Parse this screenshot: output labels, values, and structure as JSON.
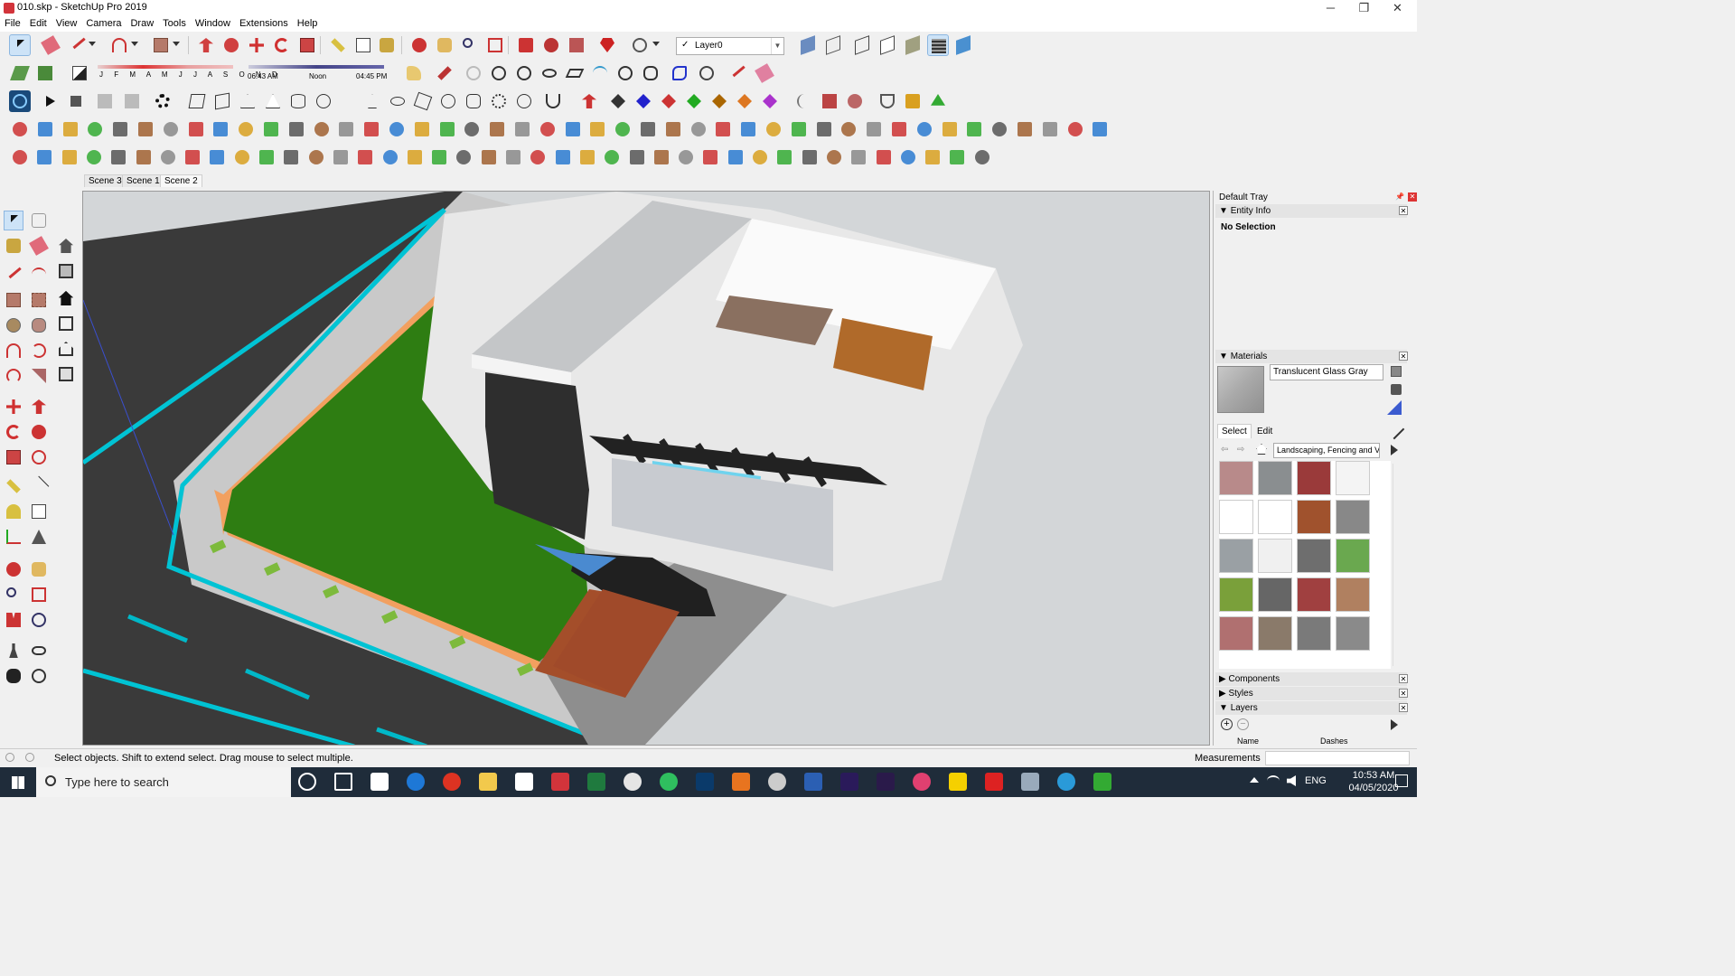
{
  "window": {
    "title": "010.skp - SketchUp Pro 2019",
    "minimize": "─",
    "maximize": "❐",
    "close": "✕"
  },
  "menu": [
    "File",
    "Edit",
    "View",
    "Camera",
    "Draw",
    "Tools",
    "Window",
    "Extensions",
    "Help"
  ],
  "layer_select": {
    "check": "✓",
    "value": "Layer0",
    "arrow": "▼"
  },
  "shadow": {
    "months": "J F M A M J J A S O N D",
    "time_start": "06:43 AM",
    "time_mid": "Noon",
    "time_end": "04:45 PM"
  },
  "scenes": [
    "Scene 3",
    "Scene 1",
    "Scene 2"
  ],
  "active_scene": "Scene 2",
  "tray": {
    "title": "Default Tray",
    "entity_info": {
      "header": "Entity Info",
      "value": "No Selection"
    },
    "materials": {
      "header": "Materials",
      "current_material": "Translucent Glass Gray",
      "tab_select": "Select",
      "tab_edit": "Edit",
      "collection": "Landscaping, Fencing and V"
    },
    "components_header": "Components",
    "styles_header": "Styles",
    "layers_header": "Layers",
    "layers_col_name": "Name",
    "layers_col_dashes": "Dashes"
  },
  "status": {
    "hint": "Select objects. Shift to extend select. Drag mouse to select multiple.",
    "measurements_label": "Measurements"
  },
  "taskbar": {
    "search_placeholder": "Type here to search",
    "language": "ENG",
    "time": "10:53 AM",
    "date": "04/05/2020"
  },
  "colors": {
    "grass": "#2e7d12",
    "road": "#3d3d3d",
    "curb_cyan": "#00c3d4",
    "pool": "#6fd3ee",
    "wood": "#a05a2c",
    "taskbar": "#1f2c3a"
  }
}
